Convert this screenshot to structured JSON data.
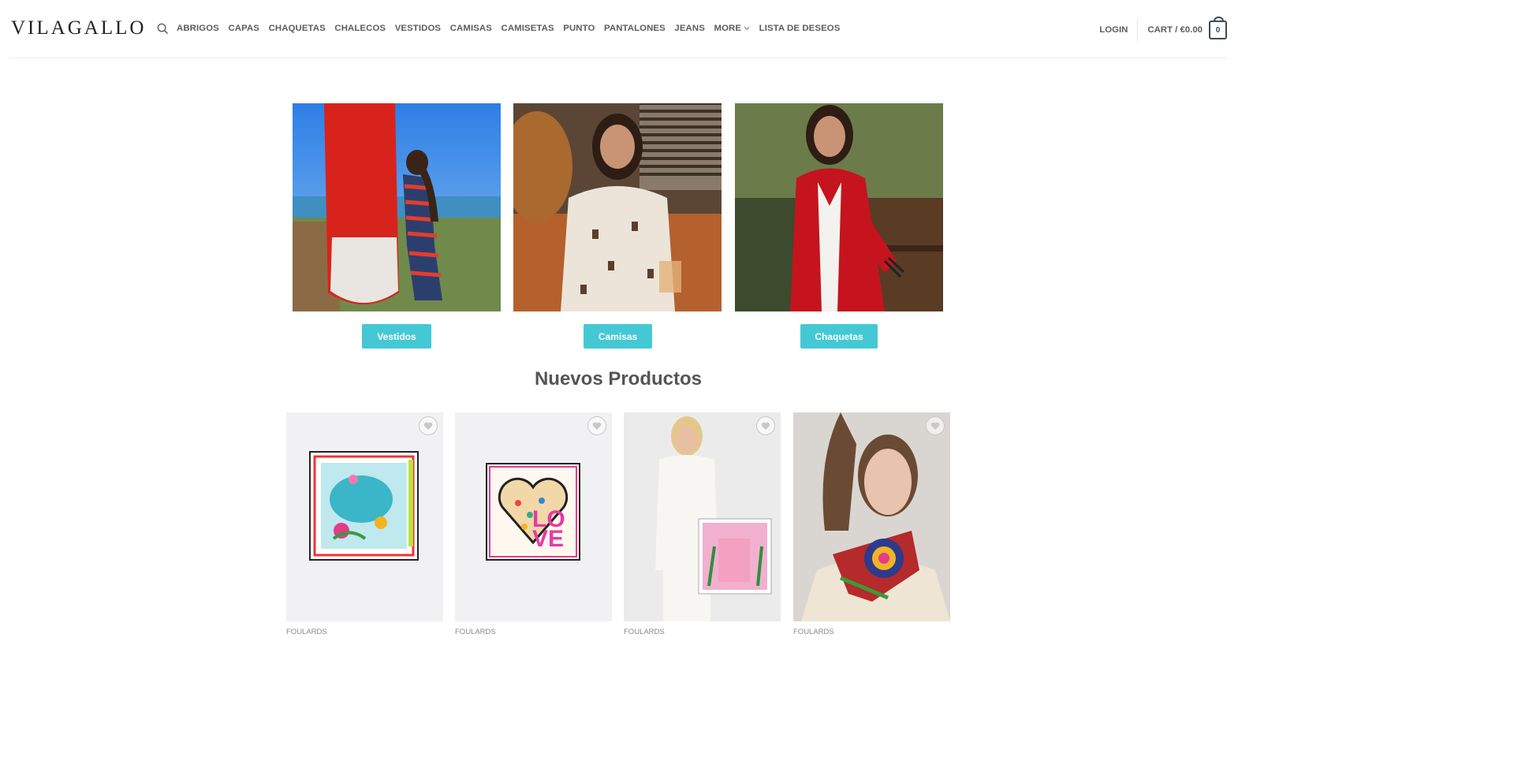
{
  "header": {
    "logo": "VILAGALLO",
    "nav": [
      "ABRIGOS",
      "CAPAS",
      "CHAQUETAS",
      "CHALECOS",
      "VESTIDOS",
      "CAMISAS",
      "CAMISETAS",
      "PUNTO",
      "PANTALONES",
      "JEANS"
    ],
    "more_label": "MORE",
    "wishlist_label": "LISTA DE DESEOS",
    "login_label": "LOGIN",
    "cart_label": "CART / €0.00",
    "cart_count": "0"
  },
  "categories": [
    {
      "label": "Vestidos"
    },
    {
      "label": "Camisas"
    },
    {
      "label": "Chaquetas"
    }
  ],
  "section_title": "Nuevos Productos",
  "products": [
    {
      "category": "FOULARDS"
    },
    {
      "category": "FOULARDS"
    },
    {
      "category": "FOULARDS"
    },
    {
      "category": "FOULARDS"
    }
  ],
  "colors": {
    "accent": "#44c9d4",
    "text": "#555555",
    "cart_border": "#3a4a5c"
  },
  "icons": [
    "search-icon",
    "chevron-down-icon",
    "cart-icon",
    "heart-icon"
  ]
}
